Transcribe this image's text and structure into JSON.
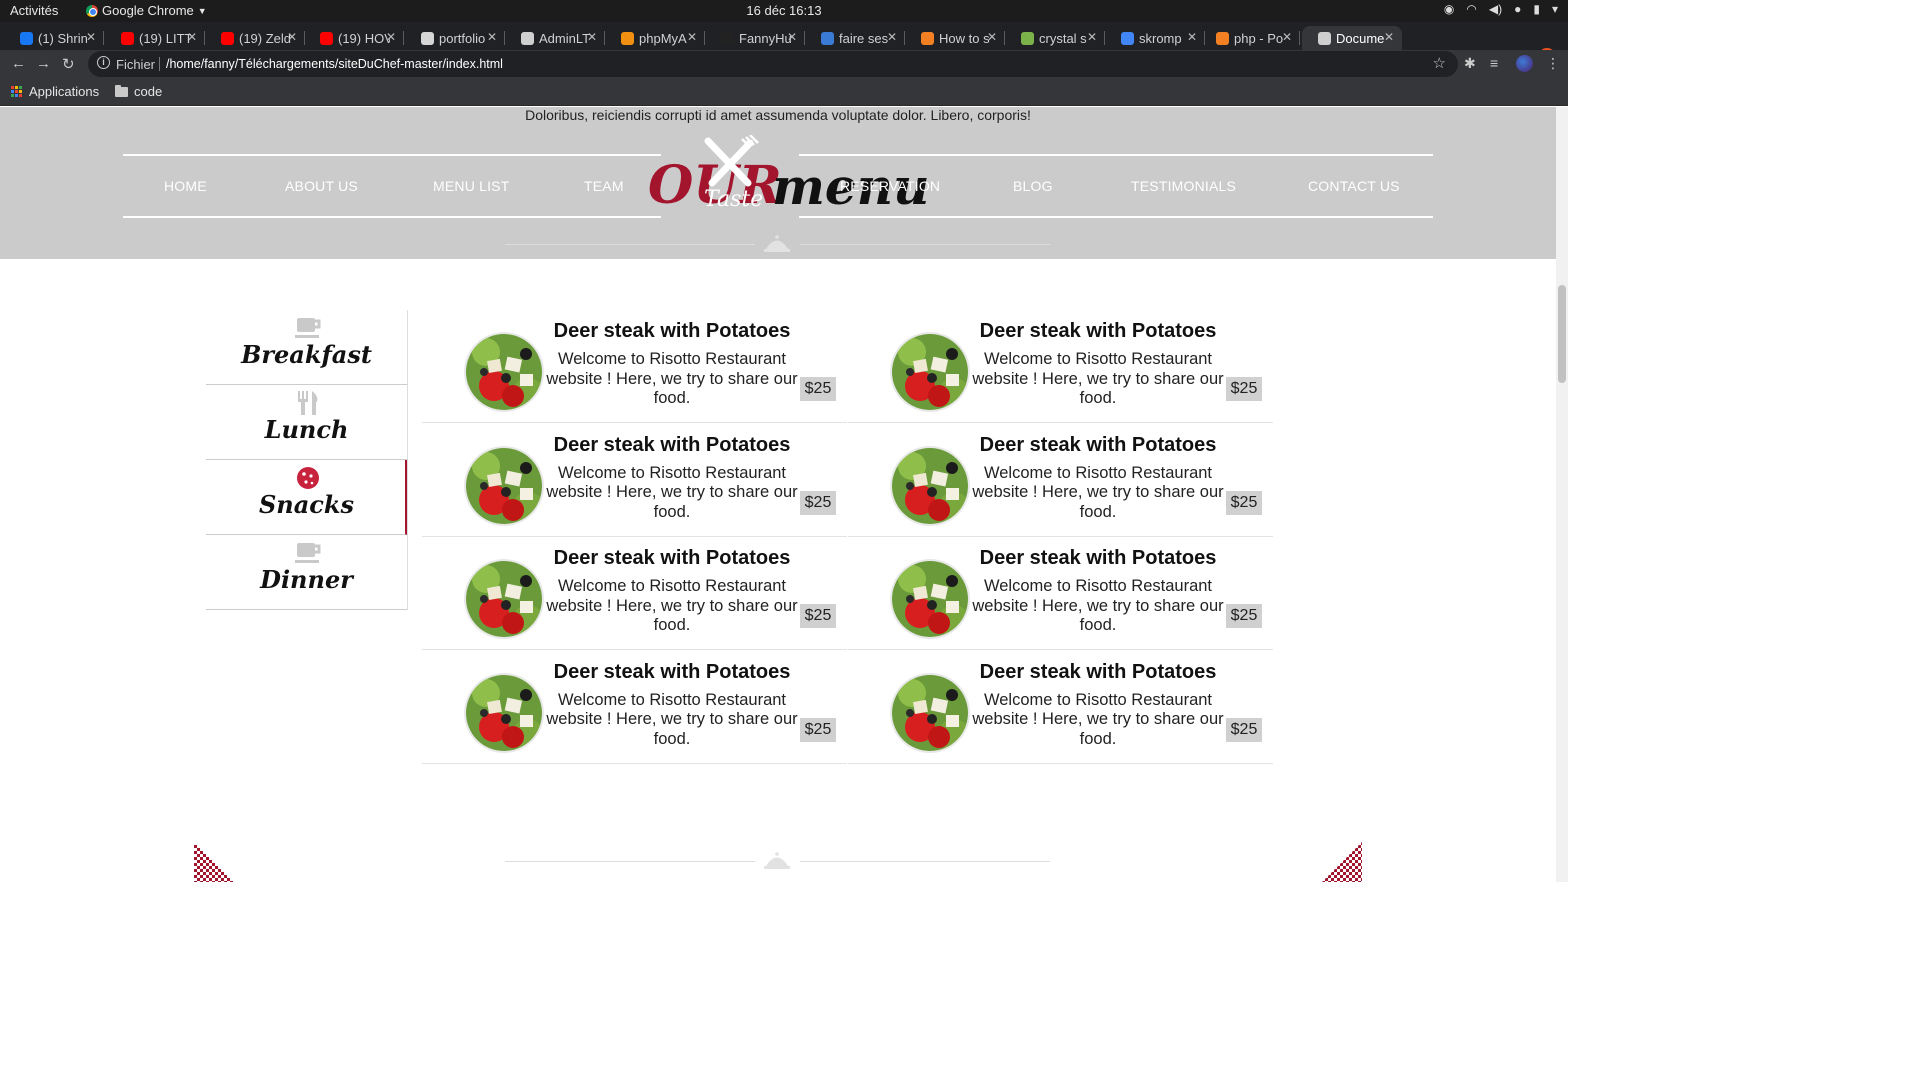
{
  "system_bar": {
    "activities": "Activités",
    "app_name": "Google Chrome",
    "clock": "16 déc  16:13"
  },
  "tabs": [
    {
      "label": "(1) Shrin",
      "color": "#1877f2"
    },
    {
      "label": "(19) LITT",
      "color": "#ff0000"
    },
    {
      "label": "(19) Zeld",
      "color": "#ff0000"
    },
    {
      "label": "(19) HOV",
      "color": "#ff0000"
    },
    {
      "label": "portfolio",
      "color": "#d6d6d6"
    },
    {
      "label": "AdminLT",
      "color": "#cfcfcf"
    },
    {
      "label": "phpMyA",
      "color": "#f29111"
    },
    {
      "label": "FannyHu",
      "color": "#222222"
    },
    {
      "label": "faire ses",
      "color": "#3a7bd5"
    },
    {
      "label": "How to s",
      "color": "#f48024"
    },
    {
      "label": "crystal s",
      "color": "#7bb34a"
    },
    {
      "label": "skromp",
      "color": "#4285f4"
    },
    {
      "label": "php - Po",
      "color": "#f48024"
    },
    {
      "label": "Docume",
      "color": "#cfcfcf",
      "active": true
    }
  ],
  "address_bar": {
    "scheme_label": "Fichier",
    "url": "/home/fanny/Téléchargements/siteDuChef-master/index.html"
  },
  "bookmarks": {
    "apps": "Applications",
    "folder": "code"
  },
  "banner": {
    "intro": "Doloribus, reiciendis corrupti id amet assumenda voluptate dolor. Libero, corporis!",
    "title_our": "OUR",
    "title_menu": "menu",
    "title_taste": "Taste"
  },
  "nav": [
    "HOME",
    "ABOUT US",
    "MENU LIST",
    "TEAM",
    "RESERVATION",
    "BLOG",
    "TESTIMONIALS",
    "CONTACT US"
  ],
  "categories": [
    {
      "label": "Breakfast",
      "icon": "coffee-cup-icon"
    },
    {
      "label": "Lunch",
      "icon": "fork-knife-icon"
    },
    {
      "label": "Snacks",
      "icon": "cookie-icon",
      "active": true
    },
    {
      "label": "Dinner",
      "icon": "coffee-cup-icon"
    }
  ],
  "dishes": [
    {
      "title": "Deer steak with Potatoes",
      "description": "Welcome to Risotto Restaurant website ! Here, we try to share our food.",
      "price": "$25"
    },
    {
      "title": "Deer steak with Potatoes",
      "description": "Welcome to Risotto Restaurant website ! Here, we try to share our food.",
      "price": "$25"
    },
    {
      "title": "Deer steak with Potatoes",
      "description": "Welcome to Risotto Restaurant website ! Here, we try to share our food.",
      "price": "$25"
    },
    {
      "title": "Deer steak with Potatoes",
      "description": "Welcome to Risotto Restaurant website ! Here, we try to share our food.",
      "price": "$25"
    },
    {
      "title": "Deer steak with Potatoes",
      "description": "Welcome to Risotto Restaurant website ! Here, we try to share our food.",
      "price": "$25"
    },
    {
      "title": "Deer steak with Potatoes",
      "description": "Welcome to Risotto Restaurant website ! Here, we try to share our food.",
      "price": "$25"
    },
    {
      "title": "Deer steak with Potatoes",
      "description": "Welcome to Risotto Restaurant website ! Here, we try to share our food.",
      "price": "$25"
    },
    {
      "title": "Deer steak with Potatoes",
      "description": "Welcome to Risotto Restaurant website ! Here, we try to share our food.",
      "price": "$25"
    }
  ],
  "colors": {
    "accent_red": "#a3142d",
    "banner_gray": "#cbcbcb",
    "price_bg": "#d0d0d0"
  }
}
